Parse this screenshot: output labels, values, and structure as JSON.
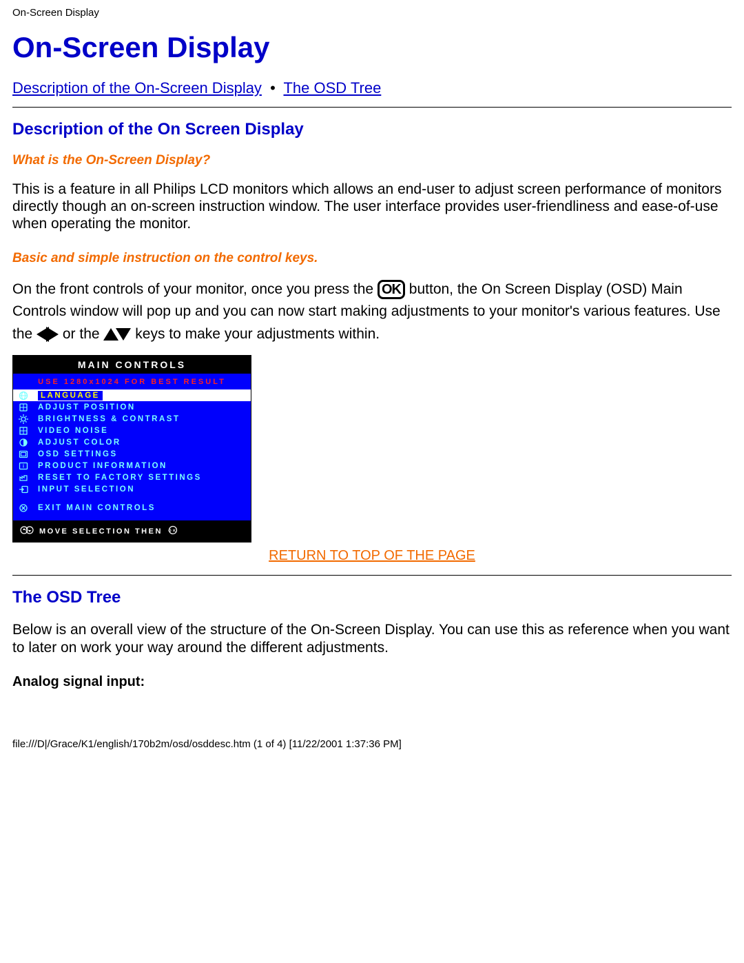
{
  "header_label": "On-Screen Display",
  "h1": "On-Screen Display",
  "nav": {
    "link1": "Description of the On-Screen Display",
    "sep": "•",
    "link2": "The OSD Tree"
  },
  "section1": {
    "heading": "Description of the On Screen Display",
    "sub1": "What is the On-Screen Display?",
    "para1": "This is a feature in all Philips LCD monitors which allows an end-user to adjust screen performance of monitors directly though an on-screen instruction window. The user interface provides user-friendliness and ease-of-use when operating the monitor.",
    "sub2": "Basic and simple instruction on the control keys.",
    "para2_a": "On the front controls of your monitor, once you press the ",
    "para2_b": " button, the On Screen Display (OSD) Main Controls window will pop up and you can now start making adjustments to your monitor's various features. Use the ",
    "para2_c": " or the ",
    "para2_d": " keys to make your adjustments within.",
    "ok_label": "OK"
  },
  "osd": {
    "title": "MAIN CONTROLS",
    "warn": "USE 1280x1024 FOR BEST RESULT",
    "items": [
      {
        "label": "LANGUAGE",
        "selected": true,
        "icon": "globe"
      },
      {
        "label": "ADJUST POSITION",
        "selected": false,
        "icon": "position"
      },
      {
        "label": "BRIGHTNESS & CONTRAST",
        "selected": false,
        "icon": "bright"
      },
      {
        "label": "VIDEO NOISE",
        "selected": false,
        "icon": "grid"
      },
      {
        "label": "ADJUST COLOR",
        "selected": false,
        "icon": "swirl"
      },
      {
        "label": "OSD SETTINGS",
        "selected": false,
        "icon": "window"
      },
      {
        "label": "PRODUCT INFORMATION",
        "selected": false,
        "icon": "info"
      },
      {
        "label": "RESET TO FACTORY SETTINGS",
        "selected": false,
        "icon": "factory"
      },
      {
        "label": "INPUT SELECTION",
        "selected": false,
        "icon": "input"
      }
    ],
    "exit": {
      "label": "EXIT MAIN CONTROLS",
      "icon": "exit"
    },
    "footer": "MOVE SELECTION THEN"
  },
  "return_link": "RETURN TO TOP OF THE PAGE",
  "section2": {
    "heading": "The OSD Tree",
    "para": "Below is an overall view of the structure of the On-Screen Display. You can use this as reference when you want to later on work your way around the different adjustments.",
    "sub": "Analog signal input:"
  },
  "footer_path": "file:///D|/Grace/K1/english/170b2m/osd/osddesc.htm (1 of 4) [11/22/2001 1:37:36 PM]"
}
